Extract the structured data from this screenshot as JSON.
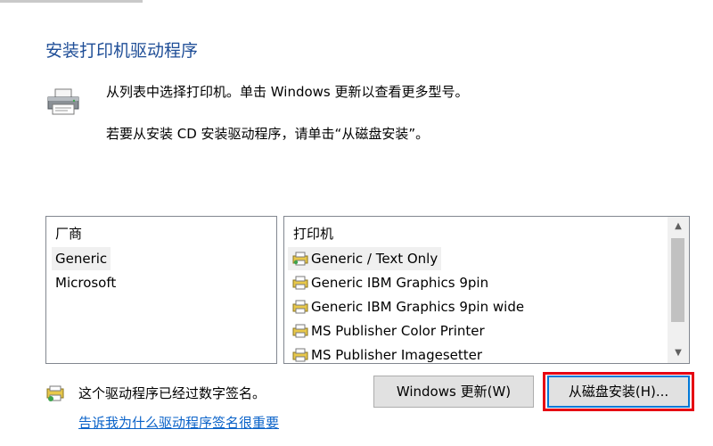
{
  "header": {
    "title": "安装打印机驱动程序"
  },
  "instructions": {
    "line1": "从列表中选择打印机。单击 Windows 更新以查看更多型号。",
    "line2": "若要从安装 CD 安装驱动程序，请单击“从磁盘安装”。"
  },
  "manufacturers": {
    "header": "厂商",
    "items": [
      "Generic",
      "Microsoft"
    ],
    "selected": "Generic"
  },
  "printers": {
    "header": "打印机",
    "items": [
      "Generic / Text Only",
      "Generic IBM Graphics 9pin",
      "Generic IBM Graphics 9pin wide",
      "MS Publisher Color Printer",
      "MS Publisher Imagesetter"
    ],
    "selected": "Generic / Text Only"
  },
  "signature": {
    "status_text": "这个驱动程序已经过数字签名。",
    "link_text": "告诉我为什么驱动程序签名很重要"
  },
  "buttons": {
    "windows_update": "Windows 更新(W)",
    "have_disk": "从磁盘安装(H)..."
  },
  "icons": {
    "header_icon": "printer-icon",
    "item_icon": "printer-driver-icon",
    "signature_icon": "signed-driver-icon"
  },
  "colors": {
    "title": "#1f4e97",
    "link": "#0b63c9",
    "highlight": "#e60012",
    "button_face": "#e1e1e1",
    "selection_inactive": "#f0f0f0"
  }
}
